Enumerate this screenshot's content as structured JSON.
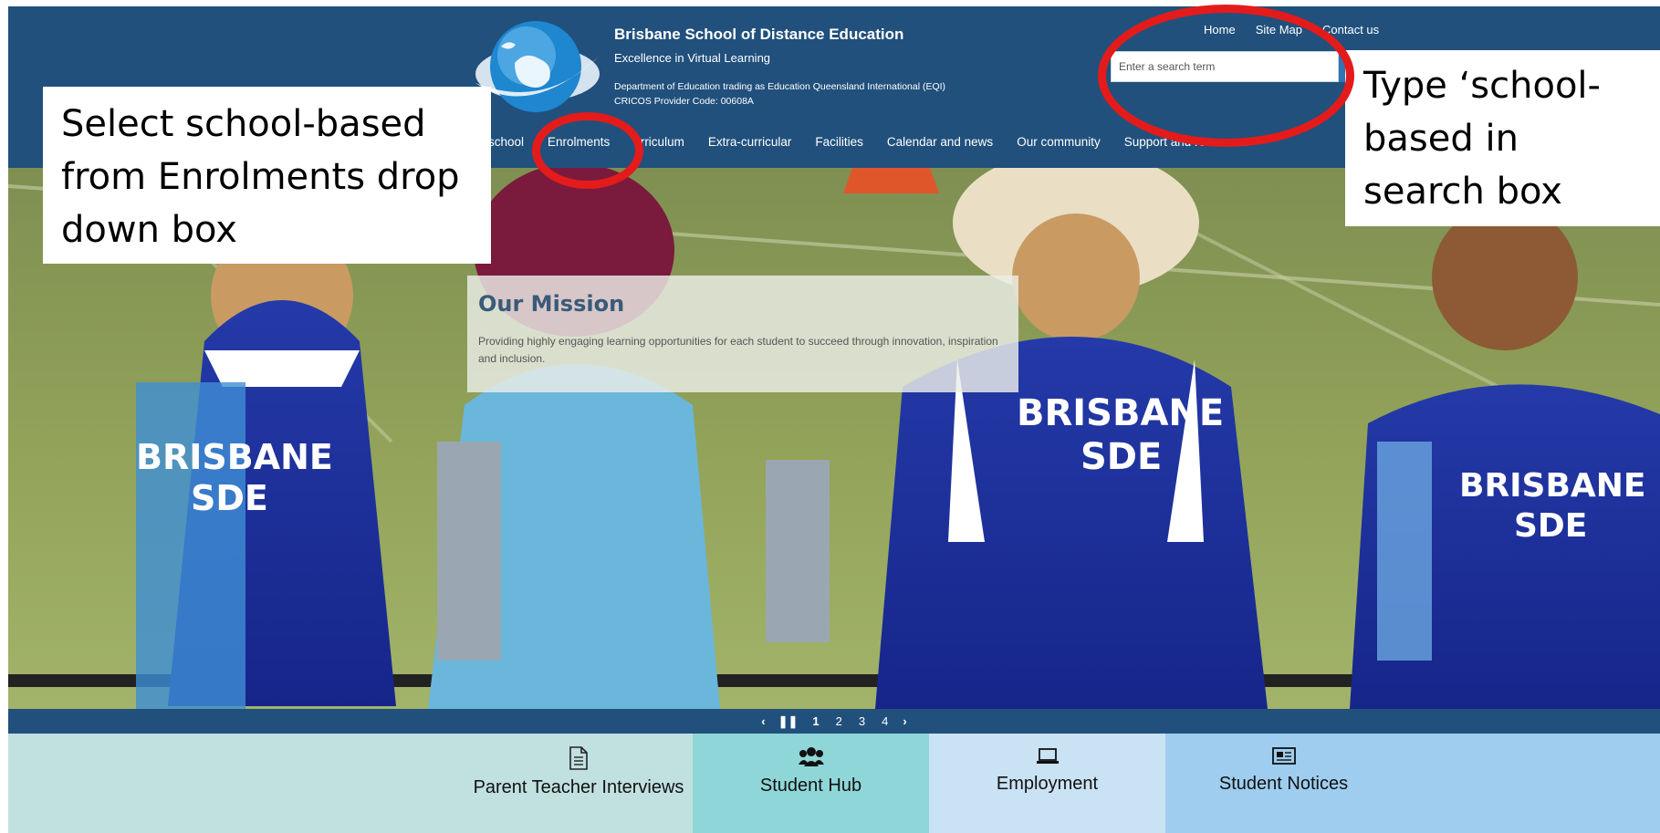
{
  "header": {
    "school_name": "Brisbane School of Distance Education",
    "tagline": "Excellence in Virtual Learning",
    "department": "Department of Education trading as Education Queensland International (EQI)",
    "cricos": "CRICOS Provider Code: 00608A",
    "util_links": [
      "Home",
      "Site Map",
      "Contact us"
    ],
    "search": {
      "placeholder": "Enter a search term"
    },
    "nav": [
      "school",
      "Enrolments",
      "urriculum",
      "Extra-curricular",
      "Facilities",
      "Calendar and news",
      "Our community",
      "Support and resources"
    ]
  },
  "hero": {
    "mission_title": "Our Mission",
    "mission_text": "Providing highly engaging learning opportunities for each student to succeed through innovation, inspiration and inclusion.",
    "shirt_text_1": "BRISBANE",
    "shirt_text_2": "SDE"
  },
  "carousel": {
    "pages": [
      "1",
      "2",
      "3",
      "4"
    ],
    "active": "1"
  },
  "quicklinks": [
    {
      "label": "Parent Teacher Interviews",
      "icon": "document-icon"
    },
    {
      "label": "Student Hub",
      "icon": "users-icon"
    },
    {
      "label": "Employment",
      "icon": "laptop-icon"
    },
    {
      "label": "Student Notices",
      "icon": "newspaper-icon"
    }
  ],
  "annotations": {
    "left": "Select school-based from Enrolments drop down box",
    "right": "Type ‘school-based in search box",
    "ring_color": "#e41b1b"
  },
  "colors": {
    "header_bg": "#21507c",
    "quicklink_1": "#c1e0e0",
    "quicklink_2": "#8fd6d8",
    "quicklink_3": "#c9e2f4",
    "quicklink_4": "#9ecdef"
  }
}
